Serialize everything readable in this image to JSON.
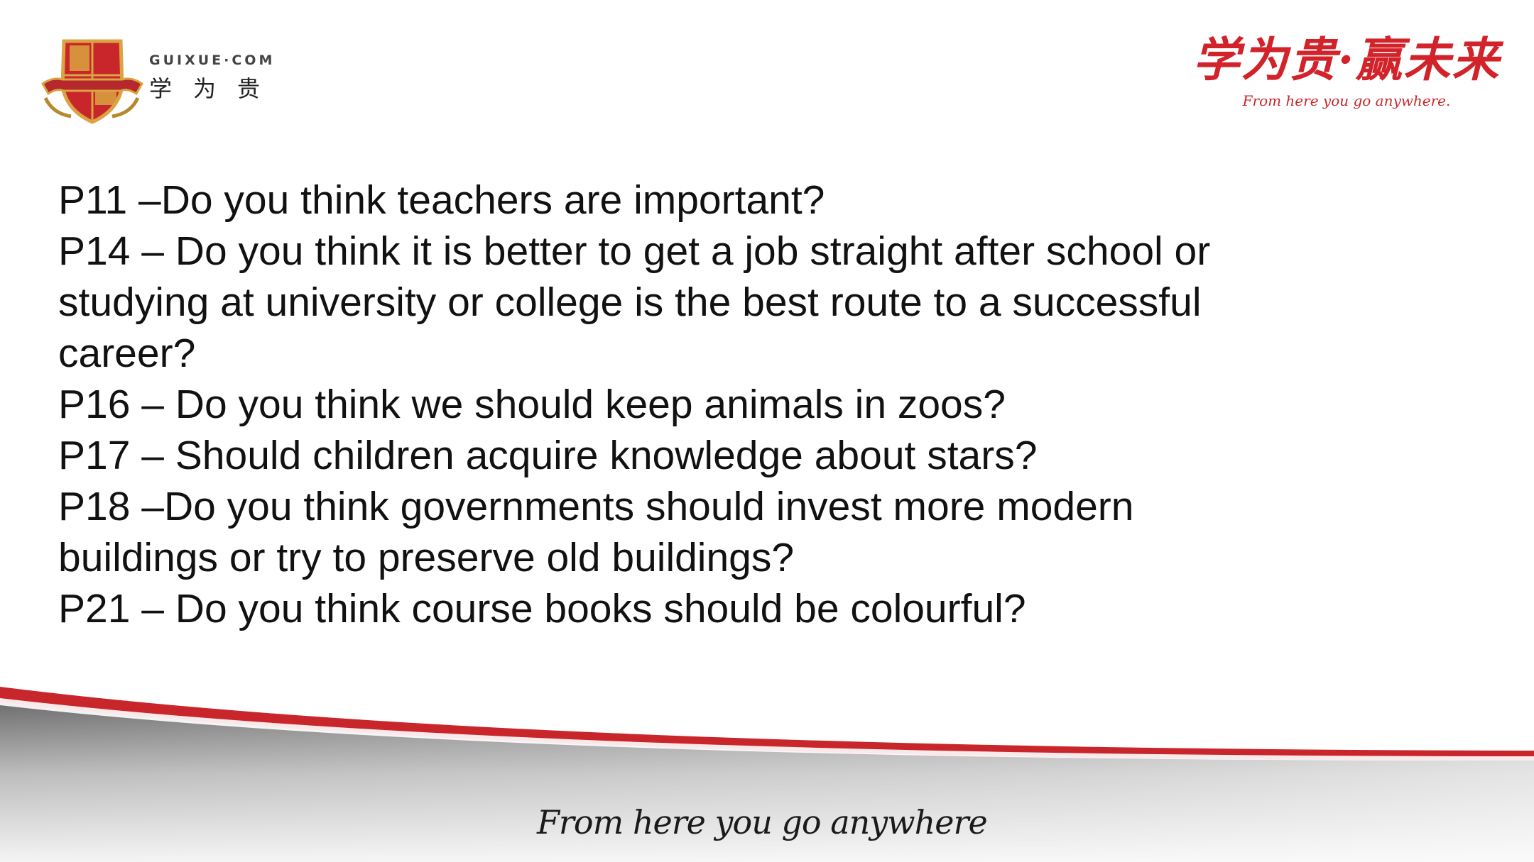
{
  "header": {
    "brand_domain": "GUIXUE·COM",
    "brand_cn": "学为贵",
    "slogan_cn": "学为贵·赢未来",
    "slogan_en": "From here you go anywhere."
  },
  "questions": [
    "P11 –Do you think teachers are important?",
    "P14 – Do you think it is better to get a job straight after school or studying at university or college is the best route to a successful career?",
    "P16 – Do you think we should keep animals in zoos?",
    "P17 – Should children acquire knowledge about stars?",
    "P18 –Do you think governments should invest more modern buildings or try to preserve old buildings?",
    "P21 – Do you think course books should be colourful?"
  ],
  "footer": {
    "tagline": "From here you go anywhere"
  },
  "colors": {
    "brand_red": "#d3232a",
    "crest_gold": "#d9a441",
    "footer_gray": "#8a8a8a"
  }
}
